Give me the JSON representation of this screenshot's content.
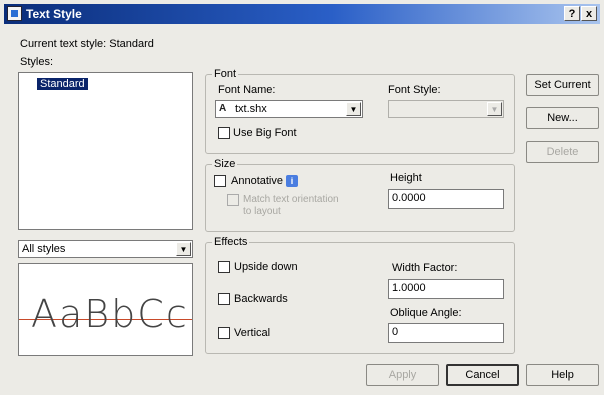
{
  "window": {
    "title": "Text Style",
    "help_btn": "?",
    "close_btn": "x"
  },
  "current_style_text": "Current text style:  Standard",
  "styles_label": "Styles:",
  "styles_list": [
    "Standard"
  ],
  "filter": {
    "value": "All styles"
  },
  "preview_text": "AaBbCc",
  "font_group": {
    "legend": "Font",
    "font_name_label": "Font Name:",
    "font_name_value": "txt.shx",
    "font_style_label": "Font Style:",
    "font_style_value": "",
    "big_font_label": "Use Big Font"
  },
  "size_group": {
    "legend": "Size",
    "annotative_label": "Annotative",
    "match_label_line1": "Match text orientation",
    "match_label_line2": "to layout",
    "height_label": "Height",
    "height_value": "0.0000"
  },
  "effects_group": {
    "legend": "Effects",
    "upside_down_label": "Upside down",
    "backwards_label": "Backwards",
    "vertical_label": "Vertical",
    "width_factor_label": "Width Factor:",
    "width_factor_value": "1.0000",
    "oblique_label": "Oblique Angle:",
    "oblique_value": "0"
  },
  "buttons": {
    "set_current": "Set Current",
    "new": "New...",
    "delete": "Delete",
    "apply": "Apply",
    "cancel": "Cancel",
    "help": "Help"
  },
  "colors": {
    "selection": "#0a246a",
    "titlebar_start": "#0a2d7a",
    "titlebar_end": "#a9c4ee"
  }
}
